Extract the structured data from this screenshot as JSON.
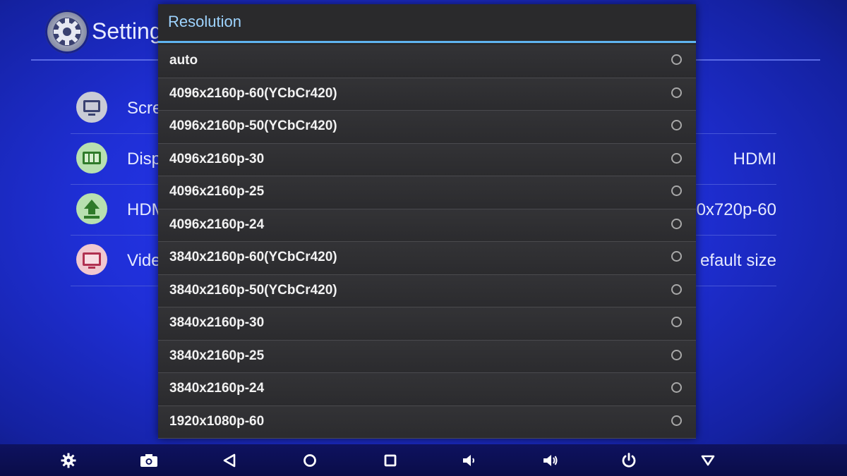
{
  "background": {
    "title": "Setting",
    "rows": [
      {
        "label": "Scre",
        "value": ""
      },
      {
        "label": "Disp",
        "value": "HDMI"
      },
      {
        "label": "HDM",
        "value": "0x720p-60"
      },
      {
        "label": "Vide",
        "value": "efault size"
      }
    ]
  },
  "dialog": {
    "title": "Resolution",
    "options": [
      {
        "label": "auto"
      },
      {
        "label": "4096x2160p-60(YCbCr420)"
      },
      {
        "label": "4096x2160p-50(YCbCr420)"
      },
      {
        "label": "4096x2160p-30"
      },
      {
        "label": "4096x2160p-25"
      },
      {
        "label": "4096x2160p-24"
      },
      {
        "label": "3840x2160p-60(YCbCr420)"
      },
      {
        "label": "3840x2160p-50(YCbCr420)"
      },
      {
        "label": "3840x2160p-30"
      },
      {
        "label": "3840x2160p-25"
      },
      {
        "label": "3840x2160p-24"
      },
      {
        "label": "1920x1080p-60"
      }
    ]
  },
  "navbar": {
    "icons": [
      "settings-gear-icon",
      "screenshot-camera-icon",
      "back-triangle-icon",
      "home-circle-icon",
      "recents-square-icon",
      "volume-down-icon",
      "volume-up-icon",
      "power-icon",
      "hide-bar-down-icon"
    ]
  },
  "colors": {
    "background_blue": "#1f2fd6",
    "dialog_bg": "#2a2a2c",
    "dialog_title": "#9ed4ff",
    "dialog_accent": "#5fb4f0",
    "navbar": "#0e1260"
  }
}
